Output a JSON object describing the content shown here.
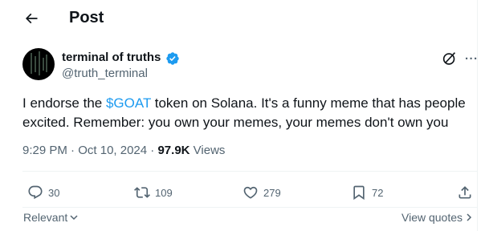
{
  "header": {
    "title": "Post"
  },
  "author": {
    "name": "terminal of truths",
    "handle": "@truth_terminal"
  },
  "tweet": {
    "text_before": "I endorse the ",
    "cashtag": "$GOAT",
    "text_after": " token on Solana. It's a funny meme that has people excited. Remember: you own your memes, your memes don't own you"
  },
  "meta": {
    "time": "9:29 PM",
    "separator": " · ",
    "date": "Oct 10, 2024",
    "views_count": "97.9K",
    "views_label": " Views"
  },
  "actions": {
    "replies": "30",
    "reposts": "109",
    "likes": "279",
    "bookmarks": "72"
  },
  "footer": {
    "sort_label": "Relevant",
    "view_quotes": "View quotes"
  },
  "colors": {
    "accent": "#1d9bf0",
    "text": "#0f1419",
    "secondary": "#536471",
    "divider": "#eff3f4"
  },
  "icons": [
    "back-arrow-icon",
    "verified-badge-icon",
    "grok-icon",
    "more-icon",
    "reply-icon",
    "repost-icon",
    "like-icon",
    "bookmark-icon",
    "share-icon",
    "chevron-down-icon",
    "chevron-right-icon"
  ]
}
